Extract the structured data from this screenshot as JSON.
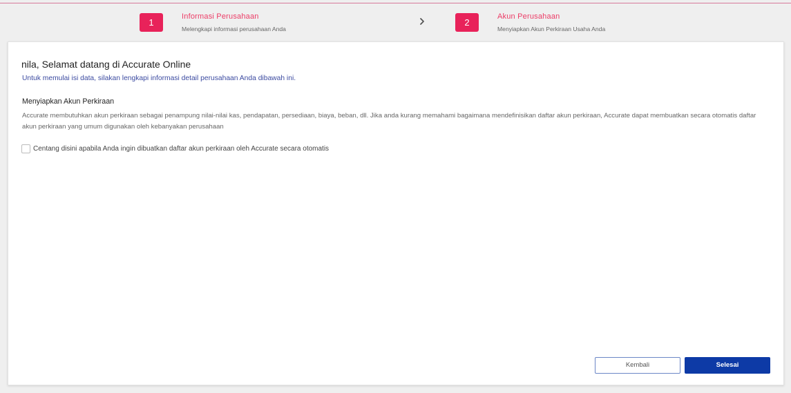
{
  "stepper": {
    "steps": [
      {
        "number": "1",
        "title": "Informasi Perusahaan",
        "subtitle": "Melengkapi informasi perusahaan Anda"
      },
      {
        "number": "2",
        "title": "Akun Perusahaan",
        "subtitle": "Menyiapkan Akun Perkiraan Usaha Anda"
      }
    ],
    "separator_icon": "chevron-right-icon"
  },
  "main": {
    "title": "nila, Selamat datang di Accurate Online",
    "subtitle": "Untuk memulai isi data, silakan lengkapi informasi detail perusahaan Anda dibawah ini.",
    "section_title": "Menyiapkan Akun Perkiraan",
    "description": "Accurate membutuhkan akun perkiraan sebagai penampung nilai-nilai kas, pendapatan, persediaan, biaya, beban, dll. Jika anda kurang memahami bagaimana mendefinisikan daftar akun perkiraan, Accurate dapat membuatkan secara otomatis daftar akun perkiraan yang umum digunakan oleh kebanyakan perusahaan",
    "checkbox_label": "Centang disini apabila Anda ingin dibuatkan daftar akun perkiraan oleh Accurate secara otomatis",
    "checkbox_checked": false
  },
  "buttons": {
    "back_label": "Kembali",
    "finish_label": "Selesai"
  },
  "colors": {
    "accent": "#e8225a",
    "primary_button": "#0d3aa6",
    "link_text": "#3b4aa0"
  }
}
